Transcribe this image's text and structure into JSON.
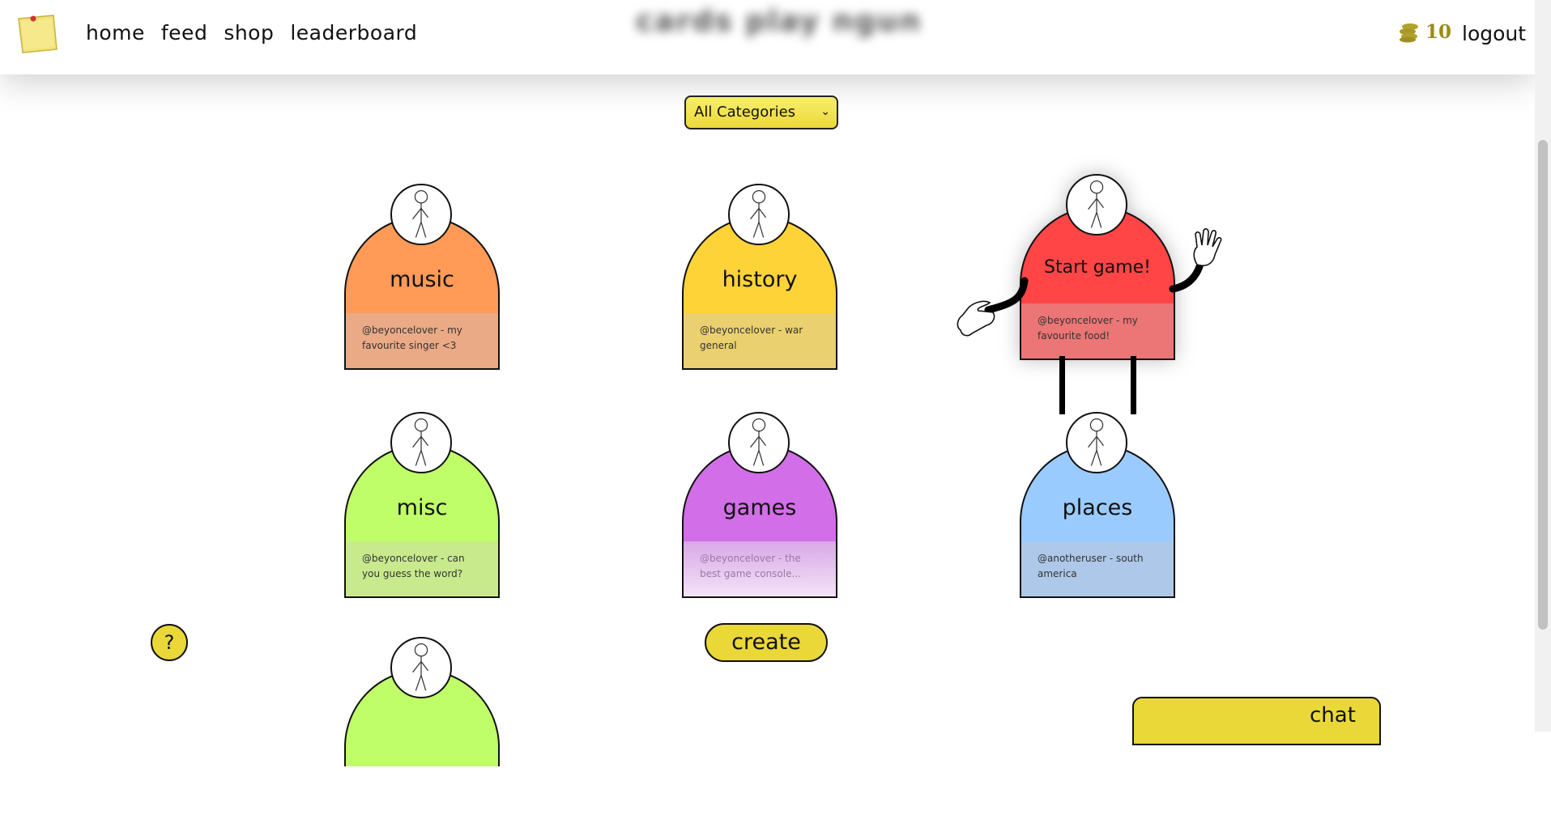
{
  "header": {
    "nav": [
      "home",
      "feed",
      "shop",
      "leaderboard"
    ],
    "blurred_title": "cards play ngun",
    "coins": "10",
    "logout": "logout"
  },
  "filter": {
    "selected": "All Categories"
  },
  "cards": [
    {
      "title": "music",
      "desc": "@beyoncelover - my favourite singer <3",
      "dome_color": "#ff9a57",
      "desc_color": "#eaaa86"
    },
    {
      "title": "history",
      "desc": "@beyoncelover - war general",
      "dome_color": "#fed337",
      "desc_color": "#ead06e"
    },
    {
      "title": "Start game!",
      "desc": "@beyoncelover - my favourite food!",
      "dome_color": "#ff4545",
      "desc_color": "#ec7575"
    },
    {
      "title": "misc",
      "desc": "@beyoncelover - can you guess the word?",
      "dome_color": "#bffe68",
      "desc_color": "#c8ea8c"
    },
    {
      "title": "games",
      "desc": "@beyoncelover - the best game console...",
      "dome_color": "#d26ee8",
      "desc_color": "#e0b4ee"
    },
    {
      "title": "places",
      "desc": "@anotheruser - south america",
      "dome_color": "#9acbfe",
      "desc_color": "#adc8e8"
    }
  ],
  "help": "?",
  "create": "create",
  "chat": "chat",
  "icons": {
    "logo": "sticky-note-icon",
    "coins": "coin-stack-icon",
    "avatar": "stick-figure-icon",
    "help": "question-icon"
  }
}
